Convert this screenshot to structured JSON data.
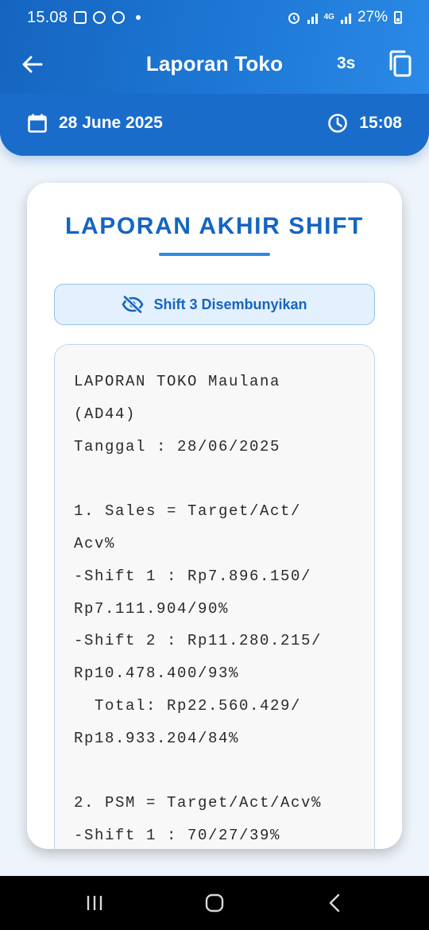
{
  "status_bar": {
    "time": "15.08",
    "network": "4G",
    "battery": "27%",
    "icons": [
      "gallery-icon",
      "whatsapp-icon",
      "app-d-icon",
      "alarm-icon",
      "signal-icon",
      "battery-icon"
    ]
  },
  "app_bar": {
    "title": "Laporan Toko",
    "timer": "3s",
    "back_icon": "arrow-left-icon",
    "copy_icon": "copy-icon"
  },
  "info_bar": {
    "date": "28 June 2025",
    "time": "15:08",
    "date_icon": "calendar-icon",
    "time_icon": "clock-icon"
  },
  "card": {
    "title": "LAPORAN AKHIR SHIFT",
    "shift_toggle_label": "Shift 3 Disembunyikan",
    "shift_toggle_icon": "eye-off-icon",
    "report_lines": [
      "LAPORAN TOKO Maulana",
      "(AD44)",
      "Tanggal : 28/06/2025",
      "",
      "1. Sales = Target/Act/",
      "Acv%",
      "-Shift 1 : Rp7.896.150/",
      "Rp7.111.904/90%",
      "-Shift 2 : Rp11.280.215/",
      "Rp10.478.400/93%",
      "  Total: Rp22.560.429/",
      "Rp18.933.204/84%",
      "",
      "2. PSM = Target/Act/Acv%",
      "-Shift 1 : 70/27/39%"
    ]
  },
  "nav_bar": {
    "recents_icon": "recents-icon",
    "home_icon": "home-icon",
    "back_icon": "back-icon"
  },
  "colors": {
    "primary": "#1565c0",
    "accent": "#2b8be6",
    "background": "#eef4fb"
  }
}
